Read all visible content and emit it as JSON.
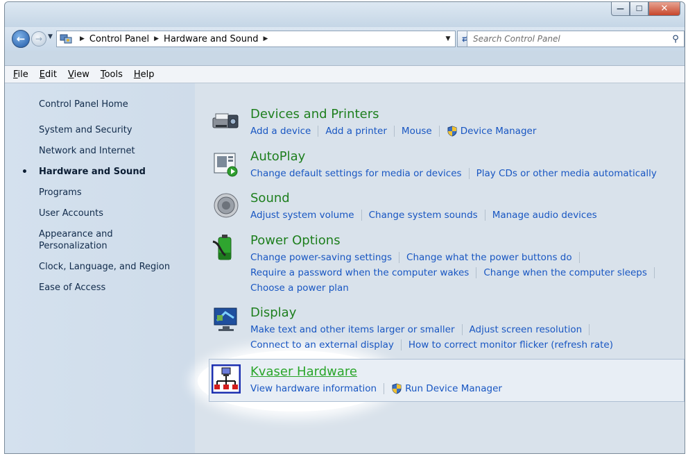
{
  "window": {
    "buttons": {
      "minimize": "—",
      "maximize": "☐",
      "close": "✕"
    }
  },
  "nav": {
    "breadcrumb": [
      "Control Panel",
      "Hardware and Sound"
    ],
    "search_placeholder": "Search Control Panel"
  },
  "menu": [
    "File",
    "Edit",
    "View",
    "Tools",
    "Help"
  ],
  "menu_underline": [
    "F",
    "E",
    "V",
    "T",
    "H"
  ],
  "sidebar": {
    "items": [
      {
        "label": "Control Panel Home"
      },
      {
        "label": "System and Security"
      },
      {
        "label": "Network and Internet"
      },
      {
        "label": "Hardware and Sound",
        "active": true
      },
      {
        "label": "Programs"
      },
      {
        "label": "User Accounts"
      },
      {
        "label": "Appearance and\nPersonalization"
      },
      {
        "label": "Clock, Language, and Region"
      },
      {
        "label": "Ease of Access"
      }
    ]
  },
  "categories": [
    {
      "title": "Devices and Printers",
      "icon": "printer-icon",
      "rows": [
        [
          "Add a device",
          "Add a printer",
          "Mouse",
          "Device Manager"
        ]
      ]
    },
    {
      "title": "AutoPlay",
      "icon": "autoplay-icon",
      "rows": [
        [
          "Change default settings for media or devices",
          "Play CDs or other media automatically"
        ]
      ]
    },
    {
      "title": "Sound",
      "icon": "speaker-icon",
      "rows": [
        [
          "Adjust system volume",
          "Change system sounds",
          "Manage audio devices"
        ]
      ]
    },
    {
      "title": "Power Options",
      "icon": "battery-icon",
      "rows": [
        [
          "Change power-saving settings",
          "Change what the power buttons do"
        ],
        [
          "Require a password when the computer wakes",
          "Change when the computer sleeps"
        ],
        [
          "Choose a power plan"
        ]
      ]
    },
    {
      "title": "Display",
      "icon": "monitor-icon",
      "rows": [
        [
          "Make text and other items larger or smaller",
          "Adjust screen resolution"
        ],
        [
          "Connect to an external display",
          "How to correct monitor flicker (refresh rate)"
        ]
      ]
    },
    {
      "title": "Kvaser Hardware",
      "icon": "kvaser-network-icon",
      "rows": [
        [
          "View hardware information",
          "Run Device Manager"
        ]
      ]
    }
  ],
  "colors": {
    "category_title": "#1e7f1e",
    "link": "#1856c2",
    "kvaser_title": "#2aa52a"
  }
}
